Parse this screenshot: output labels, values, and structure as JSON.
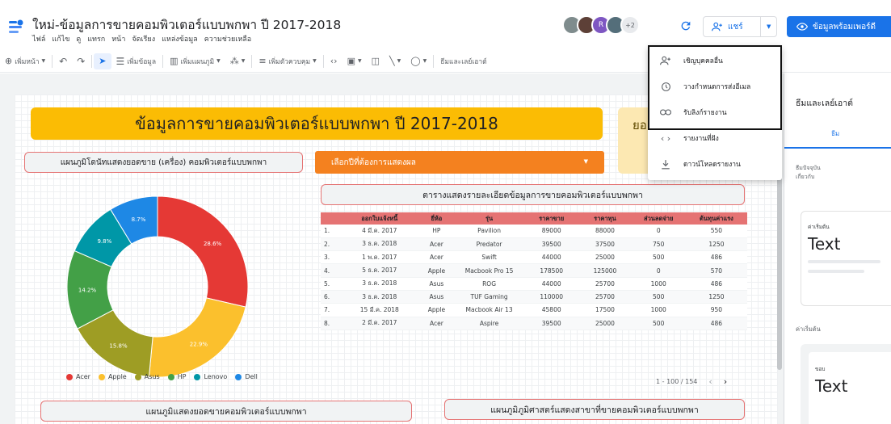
{
  "header": {
    "title": "ใหม่-ข้อมูลการขายคอมพิวเตอร์แบบพกพา ปี 2017-2018",
    "menu": [
      "ไฟล์",
      "แก้ไข",
      "ดู",
      "แทรก",
      "หน้า",
      "จัดเรียง",
      "แหล่งข้อมูล",
      "ความช่วยเหลือ"
    ],
    "avatars": [
      {
        "color": "#7f8c8d",
        "label": ""
      },
      {
        "color": "#5d4037",
        "label": ""
      },
      {
        "color": "#7e57c2",
        "label": "R"
      },
      {
        "color": "#546e7a",
        "label": ""
      }
    ],
    "avatar_more": "+2",
    "share_label": "แชร์",
    "view_label": "ข้อมูลพร้อมเพอร์ดี"
  },
  "toolbar": {
    "add_page": "เพิ่มหน้า",
    "add_data": "เพิ่มข้อมูล",
    "add_chart": "เพิ่มแผนภูมิ",
    "add_control": "เพิ่มตัวควบคุม",
    "theme_layout": "ธีมและเลย์เอาต์"
  },
  "report": {
    "title": "ข้อมูลการขายคอมพิวเตอร์แบบพกพา ปี 2017-2018",
    "yellow_partial": "ยอ",
    "donut_header": "แผนภูมิโดนัทแสดงยอดขาย (เครื่อง) คอมพิวเตอร์แบบพกพา",
    "year_select": "เลือกปีที่ต้องการแสดงผล",
    "table_header": "ตารางแสดงรายละเอียดข้อมูลการขายคอมพิวเตอร์แบบพกพา",
    "bottom_left": "แผนภูมิแสดงยอดขายคอมพิวเตอร์แบบพกพา",
    "bottom_right": "แผนภูมิภูมิศาสตร์แสดงสาขาที่ขายคอมพิวเตอร์แบบพกพา"
  },
  "chart_data": {
    "type": "pie",
    "categories": [
      "Acer",
      "Apple",
      "Asus",
      "HP",
      "Lenovo",
      "Dell"
    ],
    "values": [
      28.6,
      22.9,
      15.8,
      14.2,
      9.8,
      8.7
    ],
    "labels": [
      "28.6%",
      "22.9%",
      "15.8%",
      "14.2%",
      "9.8%",
      "8.7%"
    ],
    "colors": [
      "#e53935",
      "#fbc02d",
      "#9e9d24",
      "#43a047",
      "#0097a7",
      "#1e88e5"
    ],
    "legend_position": "bottom"
  },
  "table": {
    "columns": [
      "ออกใบแจ้งหนี้",
      "ยี่ห้อ",
      "รุ่น",
      "ราคาขาย",
      "ราคาทุน",
      "ส่วนลดจ่าย",
      "ต้นทุนค่าแรง"
    ],
    "rows": [
      [
        "1.",
        "4 มี.ค. 2017",
        "HP",
        "Pavilion",
        "89000",
        "88000",
        "0",
        "550"
      ],
      [
        "2.",
        "3 ธ.ค. 2018",
        "Acer",
        "Predator",
        "39500",
        "37500",
        "750",
        "1250"
      ],
      [
        "3.",
        "1 พ.ค. 2017",
        "Acer",
        "Swift",
        "44000",
        "25000",
        "500",
        "486"
      ],
      [
        "4.",
        "5 ธ.ค. 2017",
        "Apple",
        "Macbook Pro 15",
        "178500",
        "125000",
        "0",
        "570"
      ],
      [
        "5.",
        "3 ธ.ค. 2018",
        "Asus",
        "ROG",
        "44000",
        "25700",
        "1000",
        "486"
      ],
      [
        "6.",
        "3 ธ.ค. 2018",
        "Asus",
        "TUF Gaming",
        "110000",
        "25700",
        "500",
        "1250"
      ],
      [
        "7.",
        "15 มี.ค. 2018",
        "Apple",
        "Macbook Air 13",
        "45800",
        "17500",
        "1000",
        "950"
      ],
      [
        "8.",
        "2 มี.ค. 2017",
        "Acer",
        "Aspire",
        "39500",
        "25000",
        "500",
        "486"
      ]
    ],
    "pagination": "1 - 100 / 154"
  },
  "share_menu": {
    "items": [
      {
        "label": "เชิญบุคคลอื่น",
        "icon": "add-person-icon"
      },
      {
        "label": "วางกำหนดการส่งอีเมล",
        "icon": "clock-icon"
      },
      {
        "label": "รับลิงก์รายงาน",
        "icon": "link-icon"
      },
      {
        "label": "รายงานที่ฝัง",
        "icon": "embed-icon"
      },
      {
        "label": "ดาวน์โหลดรายงาน",
        "icon": "download-icon"
      }
    ]
  },
  "right_panel": {
    "title": "ธีมและเลย์เอาต์",
    "tab": "ธีม",
    "subtitle_1": "ธีมปัจจุบัน",
    "subtitle_2": "เกี่ยวกับ",
    "card1_small": "ค่าเริ่มต้น",
    "card1_text": "Text",
    "label_default": "ค่าเริ่มต้น",
    "card2_small": "ขอบ",
    "card2_text": "Text"
  }
}
